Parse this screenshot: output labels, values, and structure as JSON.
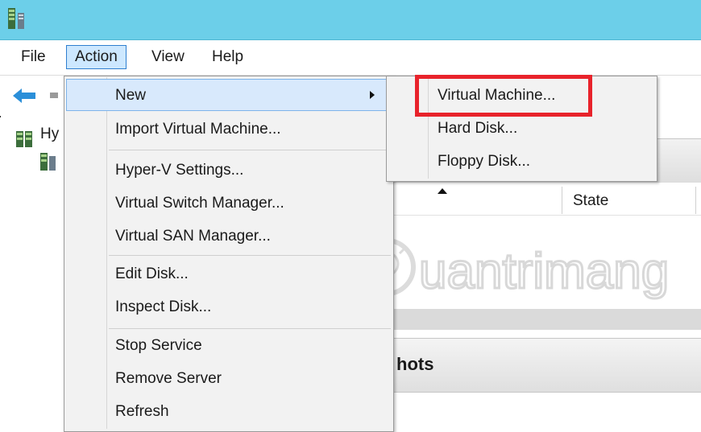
{
  "menubar": {
    "file": "File",
    "action": "Action",
    "view": "View",
    "help": "Help"
  },
  "tree": {
    "root_label": "Hy"
  },
  "context_menu": {
    "items": [
      {
        "label": "New"
      },
      {
        "label": "Import Virtual Machine..."
      },
      {
        "label": "Hyper-V Settings..."
      },
      {
        "label": "Virtual Switch Manager..."
      },
      {
        "label": "Virtual SAN Manager..."
      },
      {
        "label": "Edit Disk..."
      },
      {
        "label": "Inspect Disk..."
      },
      {
        "label": "Stop Service"
      },
      {
        "label": "Remove Server"
      },
      {
        "label": "Refresh"
      }
    ]
  },
  "submenu": {
    "items": [
      {
        "label": "Virtual Machine..."
      },
      {
        "label": "Hard Disk..."
      },
      {
        "label": "Floppy Disk..."
      }
    ]
  },
  "main": {
    "state_column": "State",
    "snapshots_partial": "hots"
  },
  "watermark": {
    "text": "uantrimang"
  },
  "colors": {
    "titlebar": "#6ccfe9",
    "highlight": "#e8232b",
    "menu_hover": "#d8e9fc",
    "menu_bg": "#f2f2f2"
  }
}
